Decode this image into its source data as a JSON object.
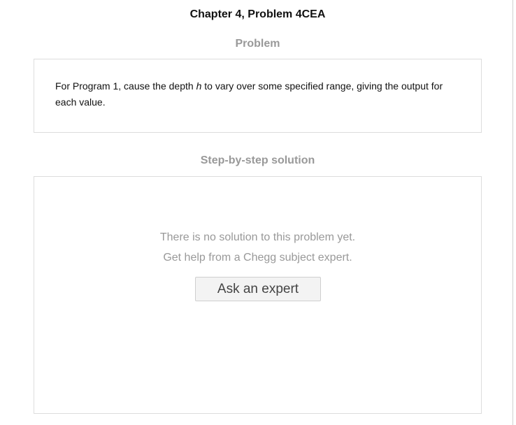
{
  "page": {
    "title": "Chapter 4, Problem 4CEA"
  },
  "problem": {
    "heading": "Problem",
    "text_before_var": "For Program 1, cause the depth ",
    "variable": "h",
    "text_after_var": " to vary over some specified range, giving the output for each value."
  },
  "solution": {
    "heading": "Step-by-step solution",
    "empty_line_1": "There is no solution to this problem yet.",
    "empty_line_2": "Get help from a Chegg subject expert.",
    "ask_button_label": "Ask an expert"
  },
  "colors": {
    "heading_muted": "#999999",
    "border": "#dddddd",
    "button_bg": "#f3f3f3"
  }
}
